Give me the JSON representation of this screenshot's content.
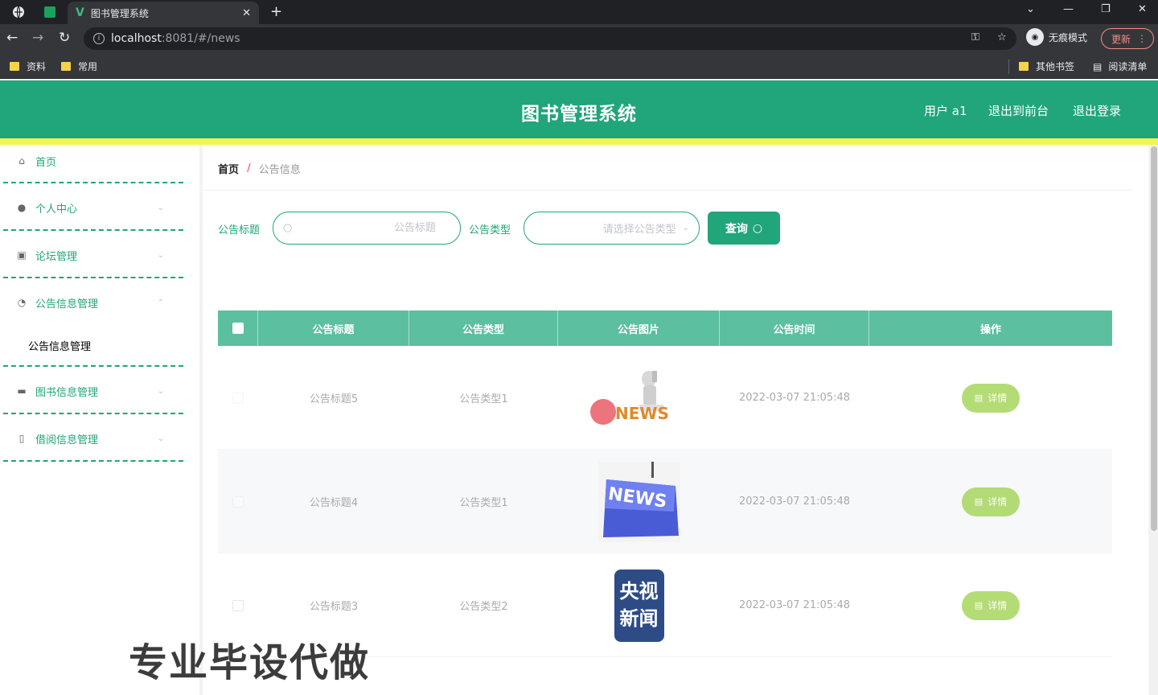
{
  "browser": {
    "tab_title": "图书管理系统",
    "tab_logo": "V",
    "url_host": "localhost",
    "url_path": ":8081/#/news",
    "incognito_label": "无痕模式",
    "update_label": "更新",
    "bookmarks": [
      {
        "label": "资料"
      },
      {
        "label": "常用"
      }
    ],
    "bookmarks_right": [
      {
        "label": "其他书签"
      },
      {
        "label": "阅读清单"
      }
    ]
  },
  "header": {
    "title": "图书管理系统",
    "user_label": "用户 a1",
    "back_front_label": "退出到前台",
    "logout_label": "退出登录"
  },
  "sidebar": {
    "items": [
      {
        "label": "首页",
        "icon": "home-icon"
      },
      {
        "label": "个人中心",
        "icon": "user-icon"
      },
      {
        "label": "论坛管理",
        "icon": "document-icon"
      },
      {
        "label": "公告信息管理",
        "icon": "gauge-icon"
      },
      {
        "label": "图书信息管理",
        "icon": "monitor-icon"
      },
      {
        "label": "借阅信息管理",
        "icon": "phone-icon"
      }
    ],
    "submenu_label": "公告信息管理"
  },
  "breadcrumb": {
    "home": "首页",
    "separator": "/",
    "current": "公告信息"
  },
  "search": {
    "title_label": "公告标题",
    "title_placeholder": "公告标题",
    "type_label": "公告类型",
    "type_placeholder": "请选择公告类型",
    "query_label": "查询"
  },
  "table": {
    "headers": [
      "公告标题",
      "公告类型",
      "公告图片",
      "公告时间",
      "操作"
    ],
    "rows": [
      {
        "title": "公告标题5",
        "type": "公告类型1",
        "image": "news-3d-figure",
        "time": "2022-03-07 21:05:48",
        "action": "详情"
      },
      {
        "title": "公告标题4",
        "type": "公告类型1",
        "image": "news-key",
        "time": "2022-03-07 21:05:48",
        "action": "详情"
      },
      {
        "title": "公告标题3",
        "type": "公告类型2",
        "image": "cctv-news",
        "time": "2022-03-07 21:05:48",
        "action": "详情"
      }
    ]
  },
  "images": {
    "news_text": "NEWS",
    "cctv_line1": "央视",
    "cctv_line2": "新闻"
  },
  "watermark": "专业毕设代做",
  "colors": {
    "primary": "#21a57a",
    "header_row": "#5bbfa0",
    "accent_bar": "#f5f552",
    "detail_button": "#a7d65e"
  }
}
